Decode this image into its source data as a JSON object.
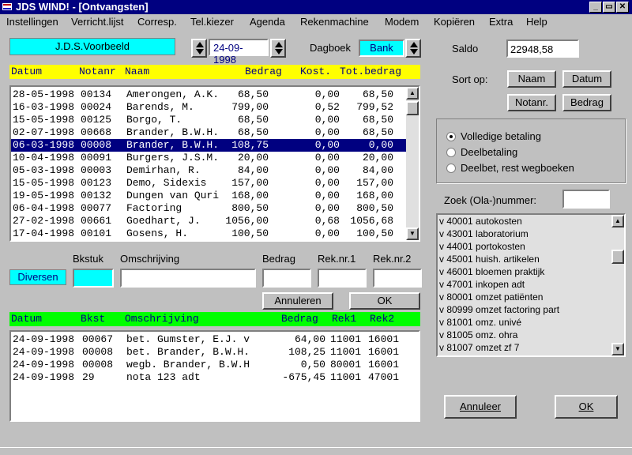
{
  "window": {
    "title": "JDS WIND! - [Ontvangsten]"
  },
  "menu": [
    "Instellingen",
    "Verricht.lijst",
    "Corresp.",
    "Tel.kiezer",
    "Agenda",
    "Rekenmachine",
    "Modem",
    "Kopiëren",
    "Extra",
    "Help"
  ],
  "company": "J.D.S.Voorbeeld",
  "date": "24-09-1998",
  "dagboek": {
    "label": "Dagboek",
    "value": "Bank"
  },
  "saldo": {
    "label": "Saldo",
    "value": "22948,58"
  },
  "sort": {
    "label": "Sort op:",
    "buttons": [
      "Naam",
      "Datum",
      "Notanr.",
      "Bedrag"
    ]
  },
  "payment_options": [
    "Volledige betaling",
    "Deelbetaling",
    "Deelbet, rest wegboeken"
  ],
  "zoek": {
    "label": "Zoek (Ola-)nummer:",
    "value": ""
  },
  "accounts": [
    "v 40001 autokosten",
    "v 43001 laboratorium",
    "v 44001 portokosten",
    "v 45001 huish. artikelen",
    "v 46001 bloemen praktijk",
    "v 47001 inkopen adt",
    "v 80001 omzet patiënten",
    "v 80999 omzet factoring part",
    "v 81001 omz. univé",
    "v 81005 omz. ohra",
    "v 81007 omzet zf 7"
  ],
  "invoice_table": {
    "headers": [
      "Datum",
      "Notanr",
      "Naam",
      "Bedrag",
      "Kost.",
      "Tot.bedrag"
    ],
    "rows": [
      [
        "28-05-1998",
        "00134",
        "Amerongen, A.K.",
        "68,50",
        "0,00",
        "68,50"
      ],
      [
        "16-03-1998",
        "00024",
        "Barends, M.",
        "799,00",
        "0,52",
        "799,52"
      ],
      [
        "15-05-1998",
        "00125",
        "Borgo, T.",
        "68,50",
        "0,00",
        "68,50"
      ],
      [
        "02-07-1998",
        "00668",
        "Brander, B.W.H.",
        "68,50",
        "0,00",
        "68,50"
      ],
      [
        "06-03-1998",
        "00008",
        "Brander, B.W.H.",
        "108,75",
        "0,00",
        "0,00"
      ],
      [
        "10-04-1998",
        "00091",
        "Burgers, J.S.M.",
        "20,00",
        "0,00",
        "20,00"
      ],
      [
        "05-03-1998",
        "00003",
        "Demirhan, R.",
        "84,00",
        "0,00",
        "84,00"
      ],
      [
        "15-05-1998",
        "00123",
        "Demo, Sidexis",
        "157,00",
        "0,00",
        "157,00"
      ],
      [
        "19-05-1998",
        "00132",
        "Dungen van Quri",
        "168,00",
        "0,00",
        "168,00"
      ],
      [
        "06-04-1998",
        "00077",
        "Factoring",
        "800,50",
        "0,00",
        "800,50"
      ],
      [
        "27-02-1998",
        "00661",
        "Goedhart, J.",
        "1056,00",
        "0,68",
        "1056,68"
      ],
      [
        "17-04-1998",
        "00101",
        "Gosens, H.",
        "100,50",
        "0,00",
        "100,50"
      ]
    ],
    "selected_index": 4
  },
  "entry": {
    "diversen": "Diversen",
    "labels": [
      "Bkstuk",
      "Omschrijving",
      "Bedrag",
      "Rek.nr.1",
      "Rek.nr.2"
    ],
    "values": [
      "",
      "",
      "",
      "",
      ""
    ],
    "annuleren": "Annuleren",
    "ok": "OK"
  },
  "booking_table": {
    "headers": [
      "Datum",
      "Bkst",
      "Omschrijving",
      "Bedrag",
      "Rek1",
      "Rek2"
    ],
    "rows": [
      [
        "24-09-1998",
        "00067",
        "bet. Gumster, E.J. v",
        "64,00",
        "11001",
        "16001"
      ],
      [
        "24-09-1998",
        "00008",
        "bet. Brander, B.W.H.",
        "108,25",
        "11001",
        "16001"
      ],
      [
        "24-09-1998",
        "00008",
        "wegb. Brander, B.W.H",
        "0,50",
        "80001",
        "16001"
      ],
      [
        "24-09-1998",
        "29",
        "nota 123 adt",
        "-675,45",
        "11001",
        "47001"
      ]
    ]
  },
  "footer": {
    "annuleer": "Annuleer",
    "ok": "OK"
  },
  "colors": {
    "title_bg": "#000080",
    "header_yellow": "#ffff00",
    "header_green": "#00ff00",
    "cyan": "#00ffff",
    "selection": "#000080"
  }
}
